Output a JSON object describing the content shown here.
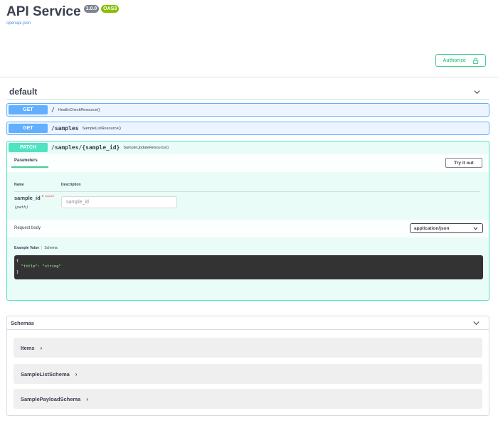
{
  "info": {
    "title": "API Service",
    "version": "1.0.0",
    "oas": "OAS3",
    "spec_link": "openapi.json"
  },
  "auth": {
    "label": "Authorize",
    "icon": "lock-icon"
  },
  "tag": {
    "name": "default"
  },
  "operations": [
    {
      "method": "GET",
      "path": "/",
      "description": "HealthCheckResource()"
    },
    {
      "method": "GET",
      "path": "/samples",
      "description": "SampleListResource()"
    },
    {
      "method": "PATCH",
      "path": "/samples/{sample_id}",
      "description": "SampleUpdateResource()"
    }
  ],
  "patch_detail": {
    "tab_parameters": "Parameters",
    "try_it_out": "Try it out",
    "col_name": "Name",
    "col_description": "Description",
    "param": {
      "name": "sample_id",
      "required_mark": "*",
      "required_text": "required",
      "in": "(path)",
      "placeholder": "sample_id"
    },
    "request_body_label": "Request body",
    "content_type": "application/json",
    "example_tab": "Example Value",
    "schema_tab": "Schema",
    "example_lines": [
      "{",
      "  \"title\": \"string\"",
      "}"
    ]
  },
  "schemas": {
    "title": "Schemas",
    "models": [
      "Items",
      "SampleListSchema",
      "SamplePayloadSchema"
    ]
  },
  "colors": {
    "get": "#61affe",
    "patch": "#50e3c2",
    "authorize": "#49cc90"
  }
}
